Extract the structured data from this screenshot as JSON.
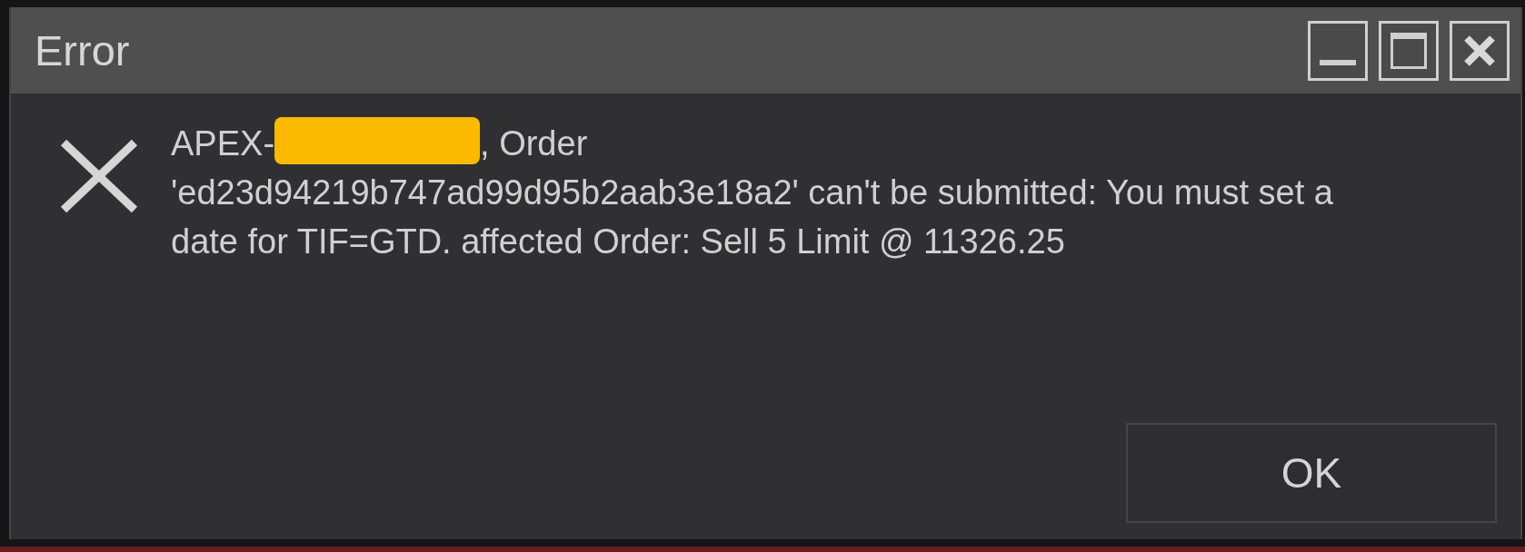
{
  "window": {
    "title": "Error"
  },
  "message": {
    "prefix": "APEX-",
    "suffix": ", Order",
    "text": "'ed23d94219b747ad99d95b2aab3e18a2' can't be submitted: You must set a date for TIF=GTD. affected Order: Sell 5 Limit @ 11326.25"
  },
  "buttons": [
    "OK"
  ]
}
